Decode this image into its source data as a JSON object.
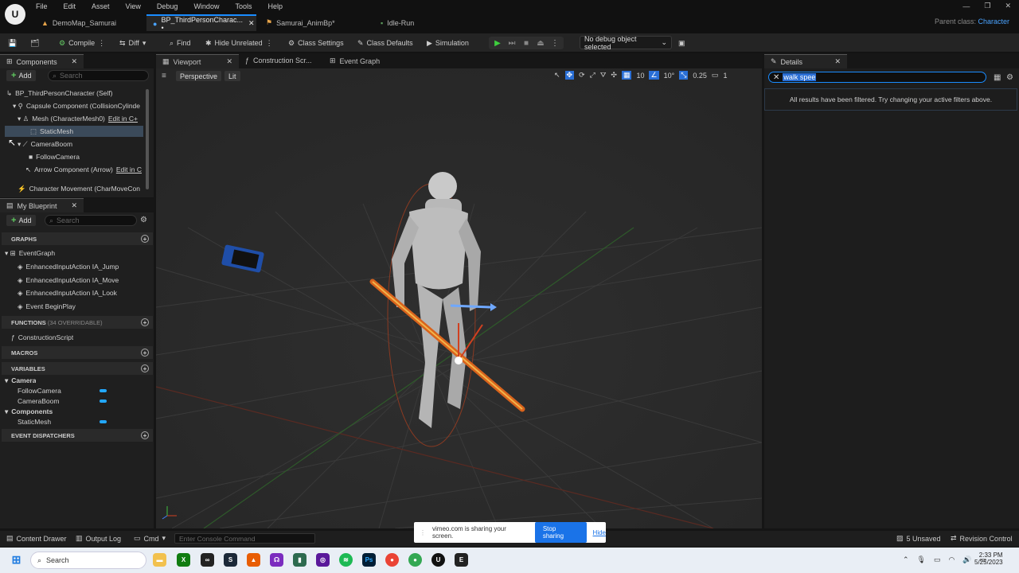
{
  "menu": [
    "File",
    "Edit",
    "Asset",
    "View",
    "Debug",
    "Window",
    "Tools",
    "Help"
  ],
  "tabs": [
    {
      "label": "DemoMap_Samurai",
      "icon": "map-icon"
    },
    {
      "label": "BP_ThirdPersonCharac... •",
      "icon": "blueprint-icon"
    },
    {
      "label": "Samurai_AnimBp*",
      "icon": "anim-icon"
    },
    {
      "label": "Idle-Run",
      "icon": "anim-icon"
    }
  ],
  "parent_class_label": "Parent class:",
  "parent_class_value": "Character",
  "toolbar": {
    "compile": "Compile",
    "diff": "Diff",
    "find": "Find",
    "hide_unrelated": "Hide Unrelated",
    "class_settings": "Class Settings",
    "class_defaults": "Class Defaults",
    "simulation": "Simulation",
    "debug_object": "No debug object selected"
  },
  "components": {
    "title": "Components",
    "add": "Add",
    "search_placeholder": "Search",
    "items": [
      {
        "label": "BP_ThirdPersonCharacter (Self)"
      },
      {
        "label": "Capsule Component (CollisionCylinde"
      },
      {
        "label": "Mesh (CharacterMesh0)",
        "edit": "Edit in C+"
      },
      {
        "label": "StaticMesh"
      },
      {
        "label": "CameraBoom"
      },
      {
        "label": "FollowCamera"
      },
      {
        "label": "Arrow Component (Arrow)",
        "edit": "Edit in C"
      },
      {
        "label": "Character Movement (CharMoveCon"
      }
    ]
  },
  "my_blueprint": {
    "title": "My Blueprint",
    "add": "Add",
    "search_placeholder": "Search",
    "graphs_header": "GRAPHS",
    "graphs": [
      "EventGraph",
      "EnhancedInputAction IA_Jump",
      "EnhancedInputAction IA_Move",
      "EnhancedInputAction IA_Look",
      "Event BeginPlay"
    ],
    "functions_header": "FUNCTIONS",
    "functions_sub": "(34 OVERRIDABLE)",
    "functions": [
      "ConstructionScript"
    ],
    "macros_header": "MACROS",
    "variables_header": "VARIABLES",
    "variables": [
      {
        "category": "Camera",
        "items": [
          "FollowCamera",
          "CameraBoom"
        ]
      },
      {
        "category": "Components",
        "items": [
          "StaticMesh"
        ]
      }
    ],
    "dispatchers_header": "EVENT DISPATCHERS"
  },
  "editor_tabs": [
    "Viewport",
    "Construction Scr...",
    "Event Graph"
  ],
  "viewport": {
    "perspective": "Perspective",
    "lit": "Lit",
    "grid": "10",
    "angle": "10°",
    "scale": "0.25",
    "cams": "1"
  },
  "details": {
    "title": "Details",
    "search_value": "walk spee",
    "message": "All results have been filtered. Try changing your active filters above."
  },
  "bottom": {
    "content_drawer": "Content Drawer",
    "output_log": "Output Log",
    "cmd": "Cmd",
    "console_placeholder": "Enter Console Command",
    "unsaved": "5 Unsaved",
    "revision": "Revision Control"
  },
  "share": {
    "message": "vimeo.com is sharing your screen.",
    "stop": "Stop sharing",
    "hide": "Hide"
  },
  "taskbar": {
    "search": "Search",
    "time": "2:33 PM",
    "date": "5/25/2023"
  }
}
